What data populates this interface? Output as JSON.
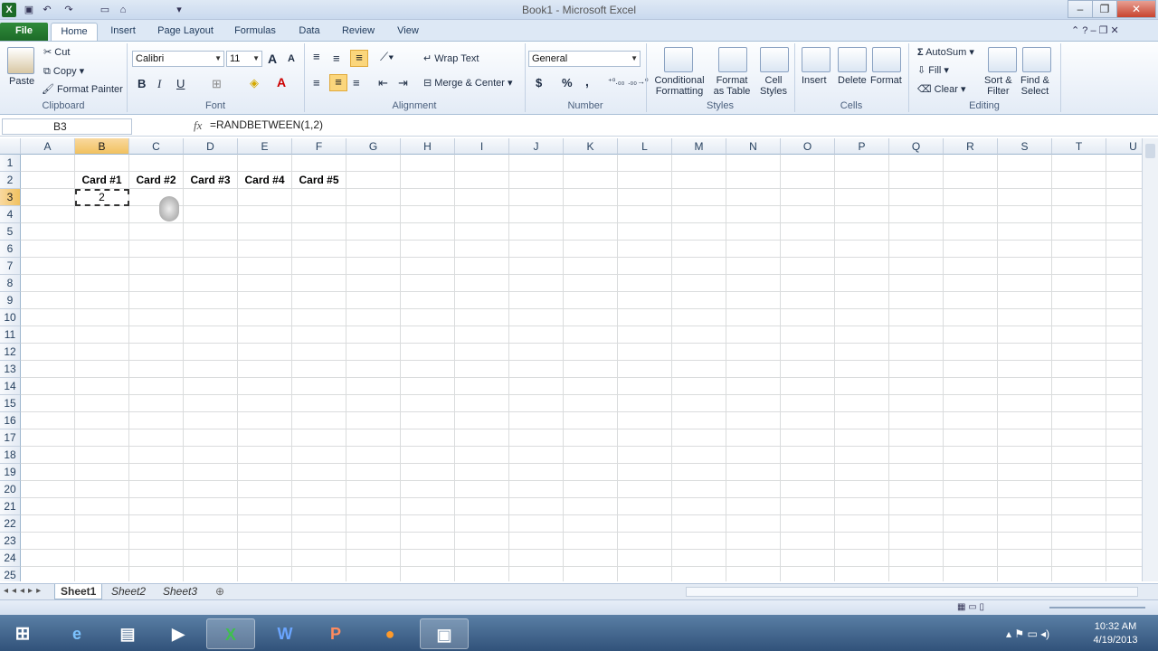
{
  "titlebar": {
    "title": "Book1 - Microsoft Excel",
    "minimize": "–",
    "restore": "❐",
    "close": "✕"
  },
  "tabs": [
    "File",
    "Home",
    "Insert",
    "Page Layout",
    "Formulas",
    "Data",
    "Review",
    "View"
  ],
  "clipboard": {
    "paste": "Paste",
    "cut": "Cut",
    "copy": "Copy",
    "format_painter": "Format Painter",
    "label": "Clipboard"
  },
  "font": {
    "name": "Calibri",
    "size": "11",
    "bold": "B",
    "italic": "I",
    "underline": "U",
    "grow": "A",
    "shrink": "A",
    "label": "Font"
  },
  "alignment": {
    "wrap_text": "Wrap Text",
    "merge_center": "Merge & Center",
    "label": "Alignment"
  },
  "number": {
    "format": "General",
    "currency": "$",
    "percent": "%",
    "comma": ",",
    "label": "Number"
  },
  "styles": {
    "conditional": "Conditional",
    "conditional2": "Formatting",
    "format_table": "Format",
    "format_table2": "as Table",
    "cell_styles": "Cell",
    "cell_styles2": "Styles",
    "label": "Styles"
  },
  "cells": {
    "insert": "Insert",
    "delete": "Delete",
    "format": "Format",
    "label": "Cells"
  },
  "editing": {
    "autosum": "AutoSum",
    "fill": "Fill",
    "clear": "Clear",
    "sort": "Sort &",
    "sort2": "Filter",
    "find": "Find &",
    "find2": "Select",
    "label": "Editing"
  },
  "formula_bar": {
    "name_box": "B3",
    "fx": "fx",
    "formula": "=RANDBETWEEN(1,2)"
  },
  "columns": [
    "A",
    "B",
    "C",
    "D",
    "E",
    "F",
    "G",
    "H",
    "I",
    "J",
    "K",
    "L",
    "M",
    "N",
    "O",
    "P",
    "Q",
    "R",
    "S",
    "T",
    "U"
  ],
  "rows": [
    "1",
    "2",
    "3",
    "4",
    "5",
    "6",
    "7",
    "8",
    "9",
    "10",
    "11",
    "12",
    "13",
    "14",
    "15",
    "16",
    "17",
    "18",
    "19",
    "20",
    "21",
    "22",
    "23",
    "24",
    "25"
  ],
  "cells_data": {
    "B2": "Card #1",
    "C2": "Card #2",
    "D2": "Card #3",
    "E2": "Card #4",
    "F2": "Card #5",
    "B3": "2"
  },
  "selected": {
    "column": "B",
    "row": "3"
  },
  "sheets": [
    "Sheet1",
    "Sheet2",
    "Sheet3"
  ],
  "active_sheet": "Sheet1",
  "taskbar": {
    "time": "10:32 AM",
    "date": "4/19/2013"
  },
  "colors": {
    "accent": "#1d6b28",
    "selection": "#f1c15f"
  }
}
